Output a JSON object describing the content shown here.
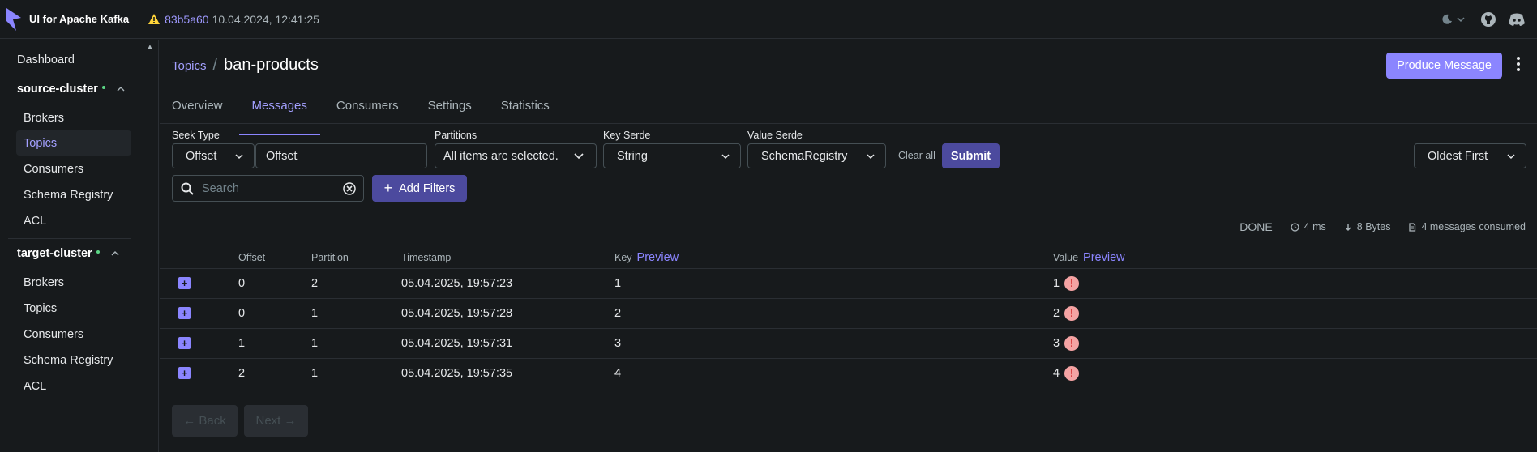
{
  "app": {
    "title": "UI for Apache Kafka"
  },
  "version": {
    "hash": "83b5a60",
    "date": "10.04.2024, 12:41:25"
  },
  "sidebar": {
    "dashboard": "Dashboard",
    "clusters": [
      {
        "name": "source-cluster",
        "items": [
          "Brokers",
          "Topics",
          "Consumers",
          "Schema Registry",
          "ACL"
        ],
        "active": "Topics"
      },
      {
        "name": "target-cluster",
        "items": [
          "Brokers",
          "Topics",
          "Consumers",
          "Schema Registry",
          "ACL"
        ]
      }
    ]
  },
  "breadcrumb": {
    "parent": "Topics",
    "current": "ban-products"
  },
  "produce_button": "Produce Message",
  "tabs": [
    "Overview",
    "Messages",
    "Consumers",
    "Settings",
    "Statistics"
  ],
  "active_tab": "Messages",
  "filters": {
    "seek_type_label": "Seek Type",
    "seek_type_value": "Offset",
    "offset_value": "Offset",
    "partitions_label": "Partitions",
    "partitions_value": "All items are selected.",
    "key_serde_label": "Key Serde",
    "key_serde_value": "String",
    "value_serde_label": "Value Serde",
    "value_serde_value": "SchemaRegistry",
    "clear_all": "Clear all",
    "submit": "Submit",
    "sort_value": "Oldest First",
    "search_placeholder": "Search",
    "add_filters": "Add Filters"
  },
  "meta": {
    "status": "DONE",
    "elapsed": "4 ms",
    "bytes": "8 Bytes",
    "consumed": "4 messages consumed"
  },
  "table": {
    "headers": {
      "offset": "Offset",
      "partition": "Partition",
      "timestamp": "Timestamp",
      "key": "Key",
      "value": "Value",
      "preview": "Preview"
    },
    "rows": [
      {
        "offset": "0",
        "partition": "2",
        "timestamp": "05.04.2025, 19:57:23",
        "key": "1",
        "value": "1"
      },
      {
        "offset": "0",
        "partition": "1",
        "timestamp": "05.04.2025, 19:57:28",
        "key": "2",
        "value": "2"
      },
      {
        "offset": "1",
        "partition": "1",
        "timestamp": "05.04.2025, 19:57:31",
        "key": "3",
        "value": "3"
      },
      {
        "offset": "2",
        "partition": "1",
        "timestamp": "05.04.2025, 19:57:35",
        "key": "4",
        "value": "4"
      }
    ]
  },
  "pagination": {
    "back": "← Back",
    "next": "Next →"
  },
  "colors": {
    "accent": "#8B85FF",
    "background": "#171A1C",
    "error": "#F5A3A3"
  }
}
